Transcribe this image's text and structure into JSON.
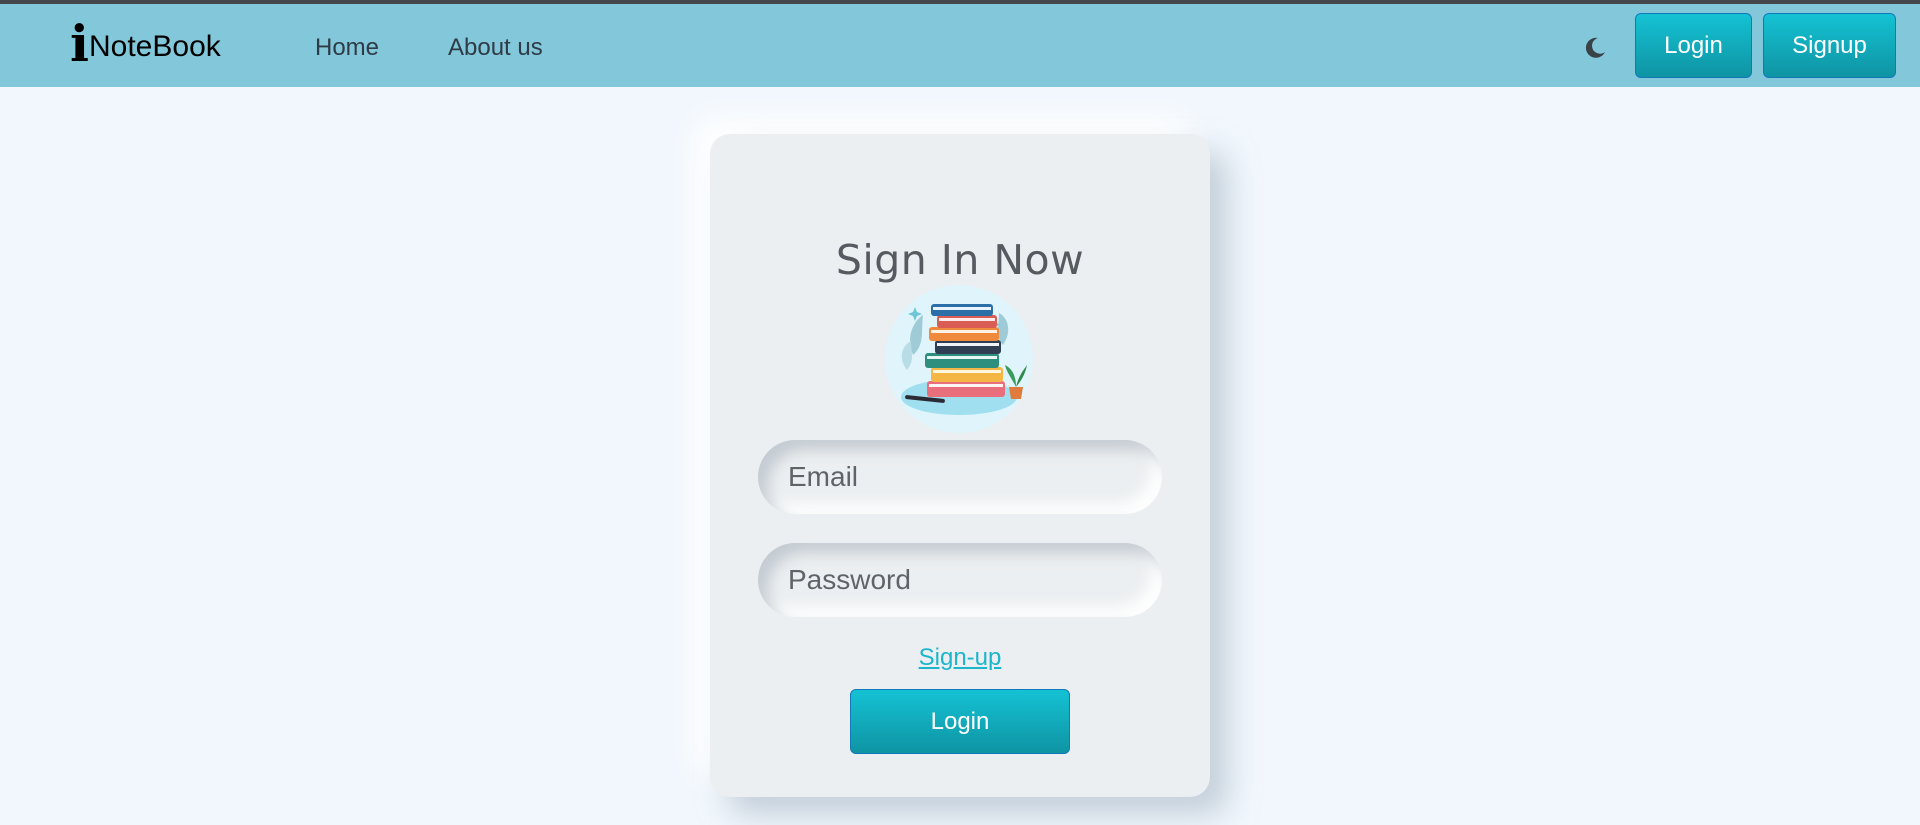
{
  "navbar": {
    "brand_i": "i",
    "brand_rest": "NoteBook",
    "links": [
      {
        "label": "Home"
      },
      {
        "label": "About us"
      }
    ],
    "theme_toggle_icon": "moon-icon",
    "login_label": "Login",
    "signup_label": "Signup"
  },
  "card": {
    "title": "Sign In Now",
    "image_icon": "stack-of-books-illustration",
    "email_placeholder": "Email",
    "password_placeholder": "Password",
    "signup_link": "Sign-up",
    "login_label": "Login"
  },
  "colors": {
    "navbar_bg": "#82c7da",
    "page_bg": "#f1f7fd",
    "accent": "#14c2d4",
    "card_bg": "#eceff1"
  }
}
